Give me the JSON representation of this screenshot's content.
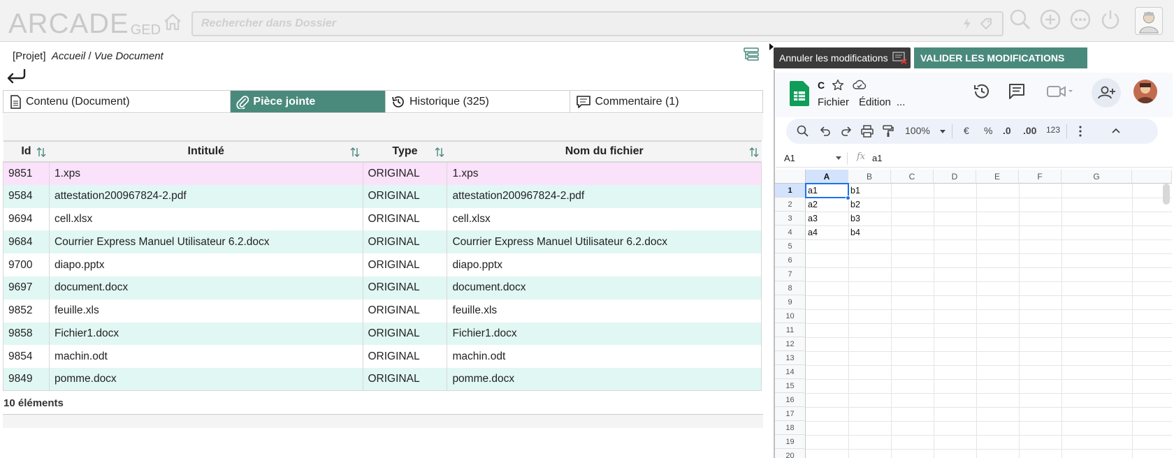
{
  "app": {
    "logo_main": "ARCADE",
    "logo_sub": "GED",
    "search_placeholder": "Rechercher dans Dossier"
  },
  "breadcrumb": {
    "project": "[Projet]",
    "home": "Accueil",
    "sep": "/",
    "current": "Vue Document"
  },
  "tabs": [
    {
      "label": "Contenu (Document)"
    },
    {
      "label": "Pièce jointe"
    },
    {
      "label": "Historique (325)"
    },
    {
      "label": "Commentaire (1)"
    }
  ],
  "table": {
    "headers": [
      "Id",
      "Intitulé",
      "Type",
      "Nom du fichier"
    ],
    "rows": [
      {
        "id": "9851",
        "title": "1.xps",
        "type": "ORIGINAL",
        "file": "1.xps"
      },
      {
        "id": "9584",
        "title": "attestation200967824-2.pdf",
        "type": "ORIGINAL",
        "file": "attestation200967824-2.pdf"
      },
      {
        "id": "9694",
        "title": "cell.xlsx",
        "type": "ORIGINAL",
        "file": "cell.xlsx"
      },
      {
        "id": "9684",
        "title": "Courrier Express Manuel Utilisateur 6.2.docx",
        "type": "ORIGINAL",
        "file": "Courrier Express Manuel Utilisateur 6.2.docx"
      },
      {
        "id": "9700",
        "title": "diapo.pptx",
        "type": "ORIGINAL",
        "file": "diapo.pptx"
      },
      {
        "id": "9697",
        "title": "document.docx",
        "type": "ORIGINAL",
        "file": "document.docx"
      },
      {
        "id": "9852",
        "title": "feuille.xls",
        "type": "ORIGINAL",
        "file": "feuille.xls"
      },
      {
        "id": "9858",
        "title": "Fichier1.docx",
        "type": "ORIGINAL",
        "file": "Fichier1.docx"
      },
      {
        "id": "9854",
        "title": "machin.odt",
        "type": "ORIGINAL",
        "file": "machin.odt"
      },
      {
        "id": "9849",
        "title": "pomme.docx",
        "type": "ORIGINAL",
        "file": "pomme.docx"
      }
    ],
    "count_label": "10 éléments"
  },
  "actions": {
    "cancel_label": "Annuler les modifications",
    "validate_label": "VALIDER LES MODIFICATIONS"
  },
  "sheets": {
    "doc_name": "C",
    "menu": [
      "Fichier",
      "Édition",
      "..."
    ],
    "zoom": "100%",
    "tb_euro": "€",
    "tb_percent": "%",
    "tb_dec_less": ".0",
    "tb_dec_more": ".00",
    "tb_123": "123",
    "cell_ref": "A1",
    "fx": "fx",
    "formula": "a1",
    "columns": [
      "A",
      "B",
      "C",
      "D",
      "E",
      "F",
      "G"
    ],
    "rows": [
      "1",
      "2",
      "3",
      "4",
      "5",
      "6",
      "7",
      "8",
      "9",
      "10",
      "11",
      "12",
      "13",
      "14",
      "15",
      "16",
      "17",
      "18",
      "19",
      "20"
    ],
    "cells": [
      [
        "a1",
        "b1"
      ],
      [
        "a2",
        "b2"
      ],
      [
        "a3",
        "b3"
      ],
      [
        "a4",
        "b4"
      ]
    ]
  },
  "colors": {
    "accent": "#4a8a7d",
    "row_alt": "#e1f7f3",
    "row_selected": "#fbe2fb",
    "sheets_green": "#0f9d58",
    "selection_blue": "#1a73e8"
  }
}
